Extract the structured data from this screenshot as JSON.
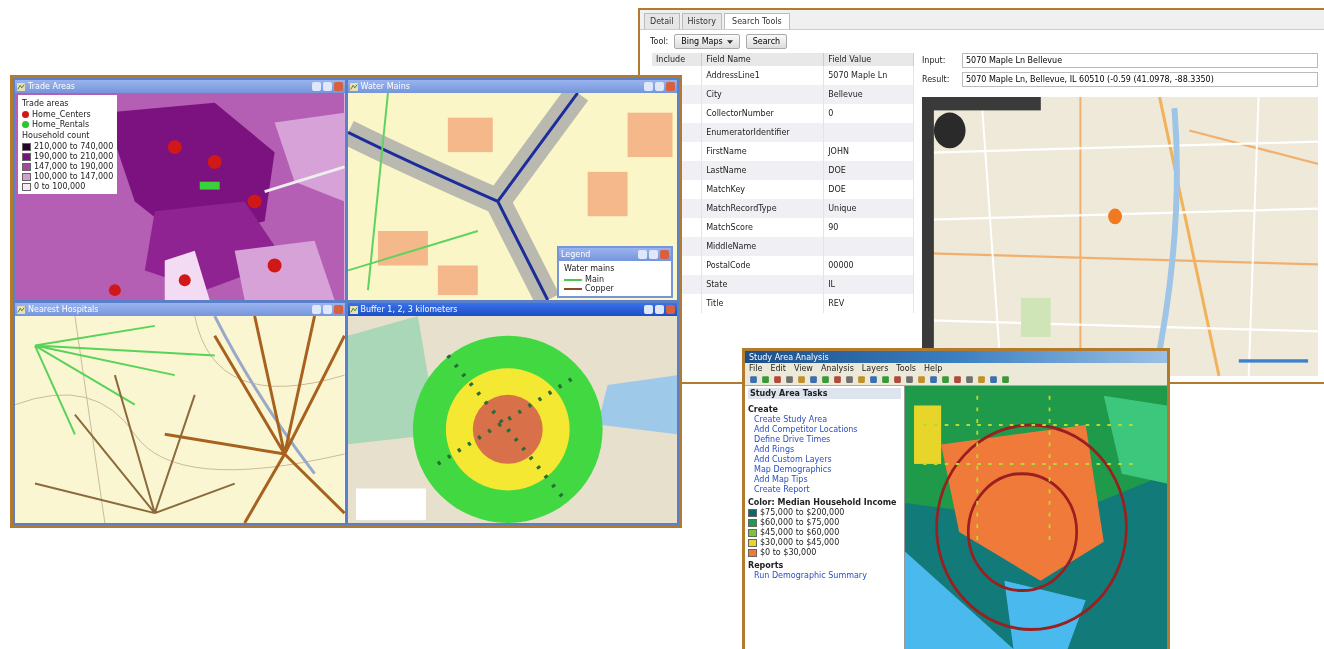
{
  "map_layout_window": {
    "panes": [
      {
        "title": "Trade Areas",
        "kind": "choropleth",
        "active": false,
        "legend": {
          "heading": "Trade areas",
          "items": [
            {
              "label": "Home_Centers",
              "color": "#d01818"
            },
            {
              "label": "Home_Rentals",
              "color": "#2cc52c"
            }
          ],
          "subheading": "Household count",
          "ranges": [
            {
              "label": "210,000 to 740,000",
              "color": "#2a0030"
            },
            {
              "label": "190,000 to 210,000",
              "color": "#7a1380"
            },
            {
              "label": "147,000 to 190,000",
              "color": "#a24aa6"
            },
            {
              "label": "100,000 to 147,000",
              "color": "#d3a0d3"
            },
            {
              "label": "0 to 100,000",
              "color": "#f6e8f6"
            }
          ]
        }
      },
      {
        "title": "Water Mains",
        "kind": "streets",
        "active": false,
        "legend": {
          "heading": "Legend",
          "subheading": "Water mains",
          "lines": [
            {
              "label": "Main",
              "color": "#4cc84c"
            },
            {
              "label": "Copper",
              "color": "#8b4a2a"
            }
          ]
        }
      },
      {
        "title": "Nearest Hospitals",
        "kind": "spider",
        "active": false
      },
      {
        "title": "Buffer 1, 2, 3 kilometers",
        "kind": "buffer",
        "active": true
      }
    ]
  },
  "search_window": {
    "tabs": [
      {
        "label": "Detail",
        "selected": false
      },
      {
        "label": "History",
        "selected": false
      },
      {
        "label": "Search Tools",
        "selected": true
      }
    ],
    "tool_label": "Tool:",
    "tool_value": "Bing Maps",
    "search_button": "Search",
    "table": {
      "columns": [
        "Include",
        "Field Name",
        "Field Value"
      ],
      "rows": [
        [
          "",
          "AddressLine1",
          "5070 Maple Ln"
        ],
        [
          "",
          "City",
          "Bellevue"
        ],
        [
          "",
          "CollectorNumber",
          "0"
        ],
        [
          "",
          "EnumeratorIdentifier",
          ""
        ],
        [
          "",
          "FirstName",
          "JOHN"
        ],
        [
          "",
          "LastName",
          "DOE"
        ],
        [
          "",
          "MatchKey",
          "DOE"
        ],
        [
          "",
          "MatchRecordType",
          "Unique"
        ],
        [
          "",
          "MatchScore",
          "90"
        ],
        [
          "",
          "MiddleName",
          ""
        ],
        [
          "",
          "PostalCode",
          "00000"
        ],
        [
          "",
          "State",
          "IL"
        ],
        [
          "",
          "Title",
          "REV"
        ]
      ]
    },
    "fields": [
      {
        "label": "Input:",
        "value": "5070 Maple Ln Bellevue"
      },
      {
        "label": "Result:",
        "value": "5070 Maple Ln, Bellevue, IL 60510 (-0.59 (41.0978, -88.3350)"
      }
    ]
  },
  "analysis_window": {
    "title": "Study Area Analysis",
    "menu": [
      "File",
      "Edit",
      "View",
      "Analysis",
      "Layers",
      "Tools",
      "Help"
    ],
    "panel": {
      "title": "Study Area Tasks",
      "sections": [
        {
          "heading": "Create",
          "links": [
            "Create Study Area",
            "Add Competitor Locations",
            "Define Drive Times",
            "Add Rings",
            "Add Custom Layers",
            "Map Demographics",
            "Add Map Tips",
            "Create Report"
          ]
        },
        {
          "heading": "Color: Median Household Income",
          "legend": [
            {
              "label": "$75,000 to $200,000",
              "color": "#0b6b6b"
            },
            {
              "label": "$60,000 to $75,000",
              "color": "#1f9a4a"
            },
            {
              "label": "$45,000 to $60,000",
              "color": "#7cc43a"
            },
            {
              "label": "$30,000 to $45,000",
              "color": "#e8d52a"
            },
            {
              "label": "$0 to $30,000",
              "color": "#f07a3a"
            }
          ]
        },
        {
          "heading": "Reports",
          "links": [
            "Run Demographic Summary"
          ]
        }
      ]
    }
  }
}
